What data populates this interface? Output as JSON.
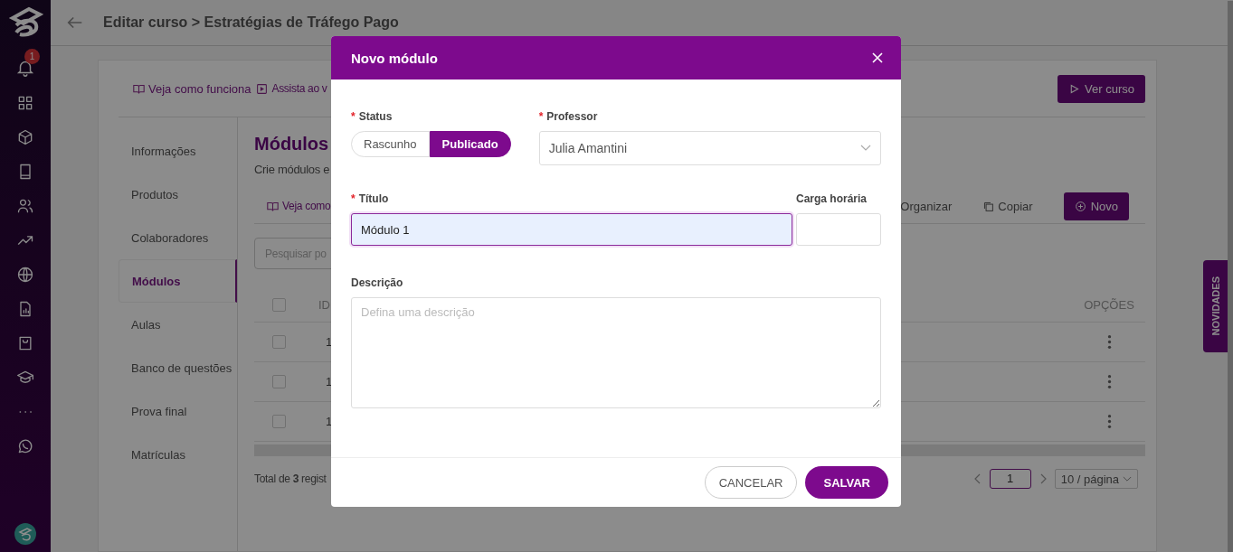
{
  "sidebar": {
    "notification_badge": "1"
  },
  "header": {
    "title": "Editar curso > Estratégias de Tráfego Pago"
  },
  "course_card": {
    "links": [
      "Veja como funciona",
      "Assista ao v"
    ],
    "view_button": "Ver curso",
    "nav": [
      {
        "label": "Informações",
        "selected": false
      },
      {
        "label": "Produtos",
        "selected": false
      },
      {
        "label": "Colaboradores",
        "selected": false
      },
      {
        "label": "Módulos",
        "selected": true
      },
      {
        "label": "Aulas",
        "selected": false
      },
      {
        "label": "Banco de questões",
        "selected": false
      },
      {
        "label": "Prova final",
        "selected": false
      },
      {
        "label": "Matrículas",
        "selected": false
      }
    ],
    "section": {
      "title": "Módulos",
      "subtitle": "Crie módulos e",
      "help_link": "Veja como",
      "organize": "Organizar",
      "copy": "Copiar",
      "new_button": "Novo",
      "search": {
        "placeholder": "Pesquisar po"
      },
      "table": {
        "columns": [
          "ID",
          "OPÇÕES"
        ],
        "header_checked": false,
        "rows": [
          {
            "id": "1",
            "checked": false
          },
          {
            "id": "1",
            "checked": false
          },
          {
            "id": "1",
            "checked": false
          }
        ]
      },
      "total": "Total de **3** regist",
      "pagination": {
        "page": "1",
        "page_size": "10 / página"
      }
    }
  },
  "novidades_tab": "NOVIDADES",
  "modal": {
    "title": "Novo módulo",
    "status": {
      "label": "Status",
      "required_mark": "*",
      "options": [
        {
          "label": "Rascunho",
          "selected": false
        },
        {
          "label": "Publicado",
          "selected": true
        }
      ]
    },
    "professor": {
      "label": "Professor",
      "required_mark": "*",
      "value": "Julia Amantini"
    },
    "title_field": {
      "label": "Título",
      "required_mark": "*",
      "value": "Módulo 1",
      "focused": true
    },
    "workload": {
      "label": "Carga horária"
    },
    "description": {
      "label": "Descrição",
      "placeholder": "Defina uma descrição"
    },
    "buttons": {
      "cancel": "CANCELAR",
      "save": "SALVAR"
    }
  }
}
